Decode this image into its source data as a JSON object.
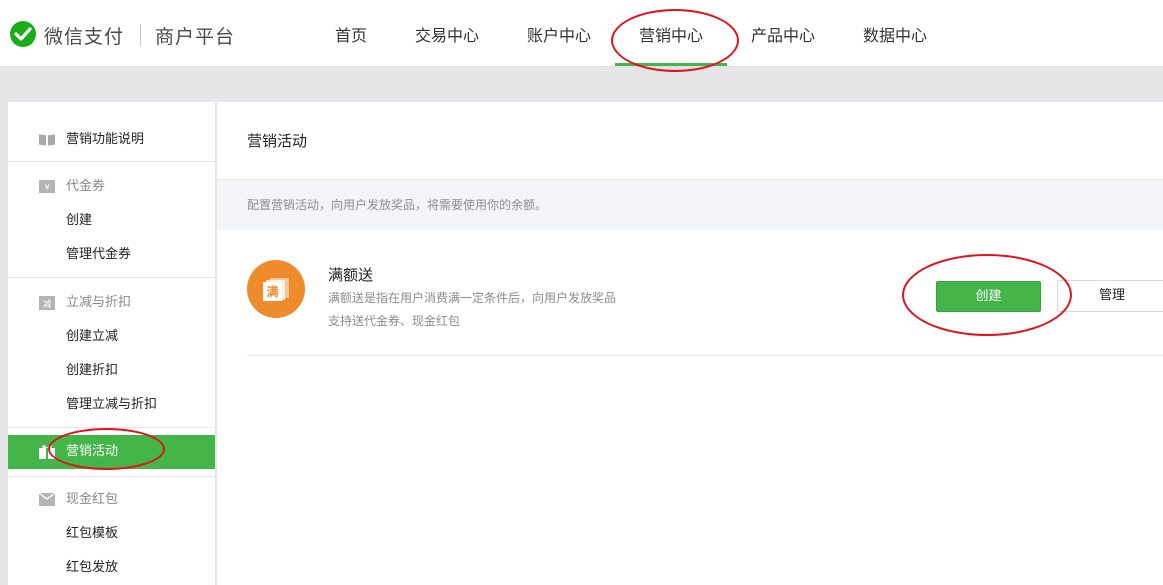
{
  "brand": {
    "name": "微信支付",
    "platform": "商户平台"
  },
  "nav": [
    {
      "label": "首页"
    },
    {
      "label": "交易中心"
    },
    {
      "label": "账户中心"
    },
    {
      "label": "营销中心",
      "active": true
    },
    {
      "label": "产品中心"
    },
    {
      "label": "数据中心"
    }
  ],
  "sidebar": {
    "marketing_intro": "营销功能说明",
    "voucher": {
      "label": "代金券",
      "items": [
        "创建",
        "管理代金券"
      ]
    },
    "discount": {
      "label": "立减与折扣",
      "items": [
        "创建立减",
        "创建折扣",
        "管理立减与折扣"
      ]
    },
    "campaign": {
      "label": "营销活动",
      "active": true
    },
    "redpacket": {
      "label": "现金红包",
      "items": [
        "红包模板",
        "红包发放"
      ]
    }
  },
  "main": {
    "title": "营销活动",
    "description": "配置营销活动，向用户发放奖品，将需要使用你的余额。",
    "activity": {
      "icon_char": "满",
      "name": "满额送",
      "desc1": "满额送是指在用户消费满一定条件后，向用户发放奖品",
      "desc2": "支持送代金券、现金红包",
      "create_label": "创建",
      "manage_label": "管理"
    }
  },
  "colors": {
    "accent": "#44b549",
    "activity_icon": "#f08b2c",
    "annotation": "#e0121c"
  }
}
